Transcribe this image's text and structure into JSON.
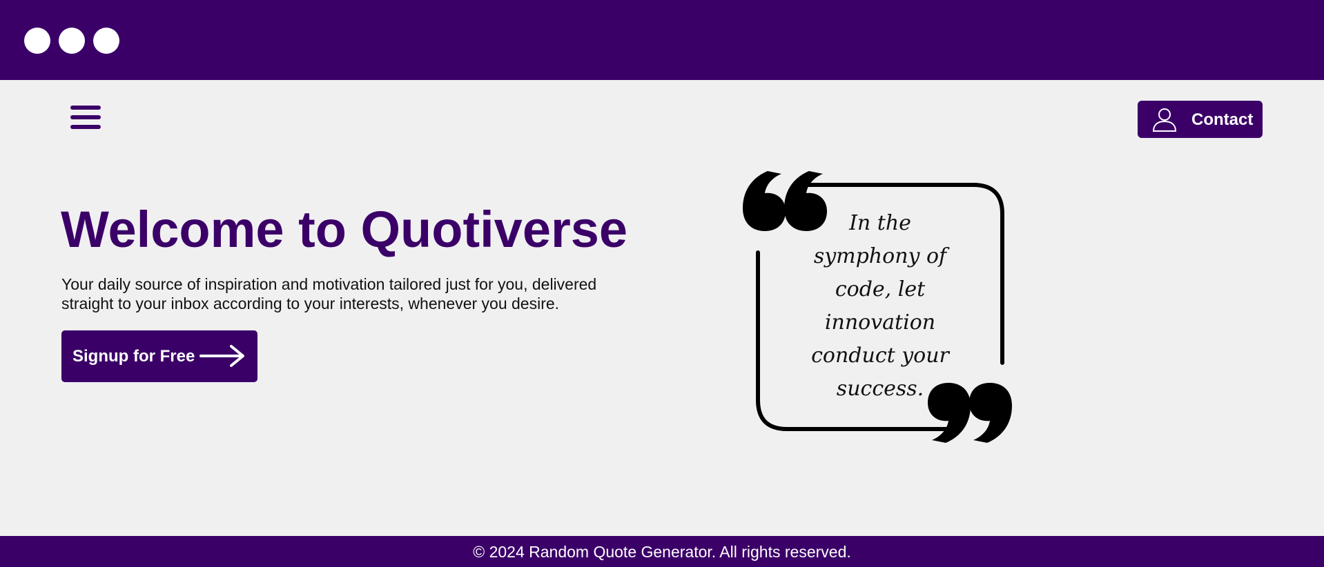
{
  "window": {
    "controls": [
      "dot",
      "dot",
      "dot"
    ]
  },
  "nav": {
    "menu_icon": "hamburger-menu-icon",
    "contact": {
      "label": "Contact",
      "icon": "person-icon"
    }
  },
  "hero": {
    "title": "Welcome to Quotiverse",
    "description": "Your daily source of inspiration and motivation tailored just for you, delivered straight to your inbox according to your interests, whenever you desire.",
    "signup": {
      "label": "Signup for Free",
      "icon": "arrow-right-icon"
    }
  },
  "quote": {
    "lines": [
      "In the",
      "symphony of",
      "code, let",
      "innovation",
      "conduct your",
      "success."
    ]
  },
  "footer": {
    "text": "© 2024 Random Quote Generator. All rights reserved."
  },
  "colors": {
    "brand": "#3b0068",
    "background": "#f0f0f1",
    "text": "#111111",
    "on_brand": "#ffffff"
  }
}
